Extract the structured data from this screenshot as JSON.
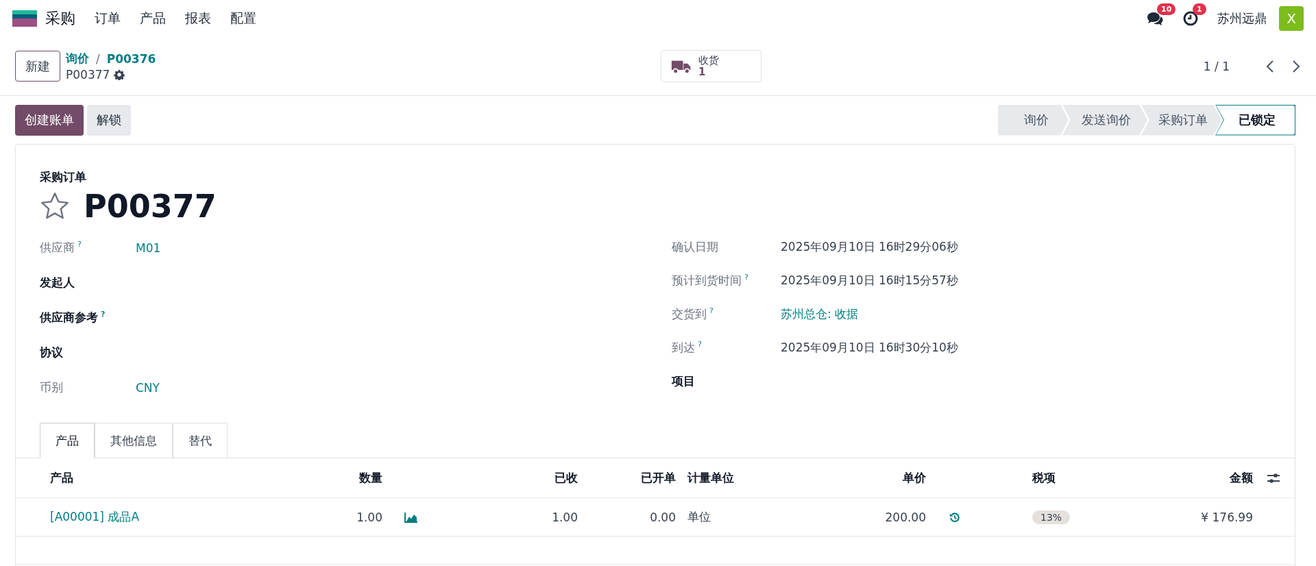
{
  "navbar": {
    "app_name": "采购",
    "menu": [
      "订单",
      "产品",
      "报表",
      "配置"
    ],
    "messages_badge": "10",
    "activities_badge": "1",
    "company": "苏州远鼎",
    "avatar_letter": "X"
  },
  "control_panel": {
    "new_button": "新建",
    "breadcrumbs": [
      "询价",
      "P00376"
    ],
    "separator": "/",
    "current": "P00377",
    "smart_button": {
      "label": "收货",
      "count": "1"
    },
    "pager": "1 / 1"
  },
  "actions": [
    {
      "label": "创建账单",
      "kind": "primary"
    },
    {
      "label": "解锁",
      "kind": "secondary"
    }
  ],
  "statusbar": [
    {
      "label": "询价",
      "selected": false
    },
    {
      "label": "发送询价",
      "selected": false
    },
    {
      "label": "采购订单",
      "selected": false
    },
    {
      "label": "已锁定",
      "selected": true
    }
  ],
  "sheet": {
    "subtitle": "采购订单",
    "title": "P00377",
    "starred": false,
    "left_fields": [
      {
        "label": "供应商",
        "help_mark": "?",
        "value": "M01",
        "kind": "link",
        "editable": false
      },
      {
        "label": "发起人",
        "editable": true
      },
      {
        "label": "供应商参考",
        "help_mark": "?",
        "editable": true
      },
      {
        "label": "协议",
        "editable": true
      },
      {
        "label": "币别",
        "value": "CNY",
        "kind": "link",
        "editable": false
      }
    ],
    "right_fields": [
      {
        "label": "确认日期",
        "value": "2025年09月10日 16时29分06秒",
        "kind": "text",
        "editable": false
      },
      {
        "label": "预计到货时间",
        "help_mark": "?",
        "value": "2025年09月10日 16时15分57秒",
        "kind": "text",
        "editable": false
      },
      {
        "label": "交货到",
        "help_mark": "?",
        "value": "苏州总仓: 收据",
        "kind": "link",
        "editable": false
      },
      {
        "label": "到达",
        "help_mark": "?",
        "value": "2025年09月10日 16时30分10秒",
        "kind": "text",
        "editable": false
      },
      {
        "label": "项目",
        "editable": true
      }
    ],
    "tabs": [
      {
        "label": "产品",
        "selected": true
      },
      {
        "label": "其他信息",
        "selected": false
      },
      {
        "label": "替代",
        "selected": false
      }
    ],
    "table": {
      "columns": [
        "产品",
        "数量",
        "已收",
        "已开单",
        "计量单位",
        "单价",
        "税项",
        "金额"
      ],
      "rows": [
        {
          "product": "[A00001] 成品A",
          "quantity": "1.00",
          "received": "1.00",
          "billed": "0.00",
          "uom": "单位",
          "unit_price": "200.00",
          "taxes": [
            "13%"
          ],
          "amount": "¥ 176.99"
        }
      ]
    }
  }
}
